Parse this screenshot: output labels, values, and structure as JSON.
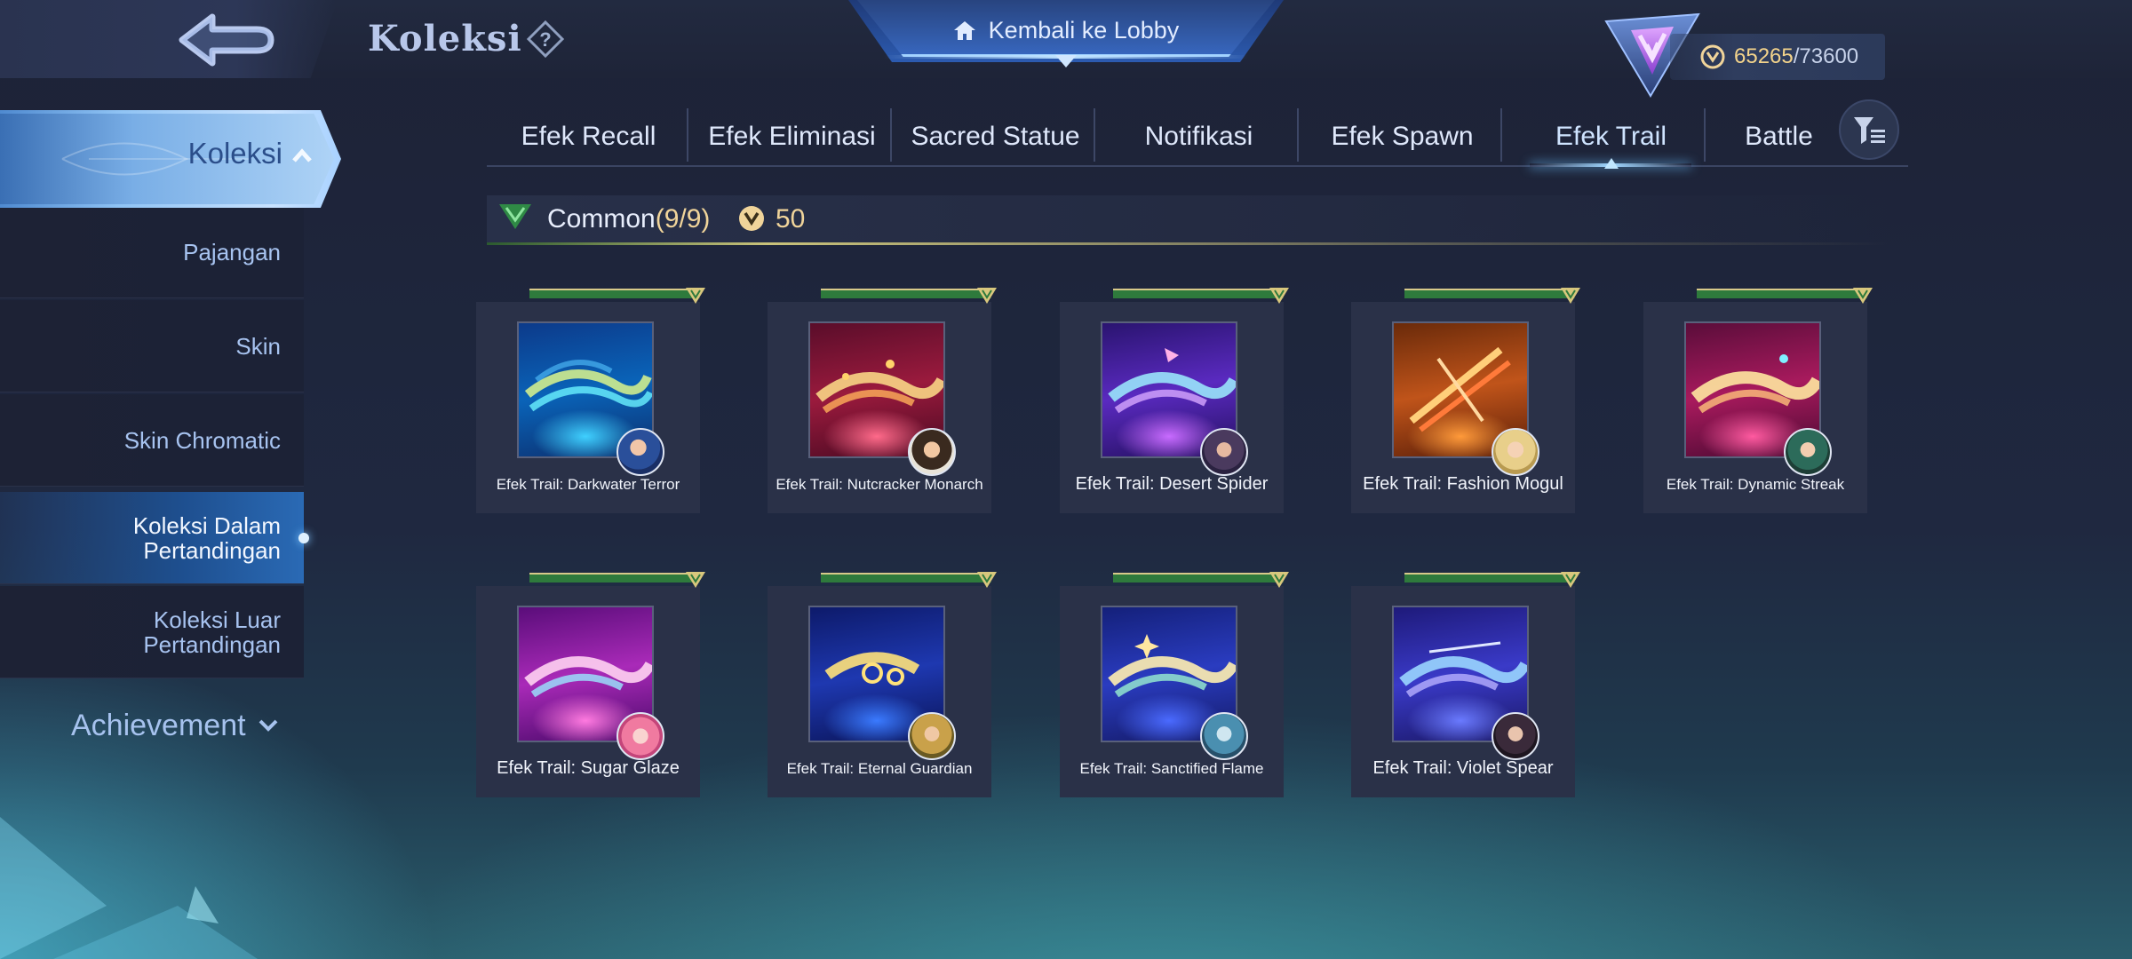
{
  "header": {
    "title": "Koleksi",
    "lobby_label": "Kembali ke Lobby",
    "currency_amount": "65265",
    "currency_max": "/73600"
  },
  "sidebar": {
    "section_label": "Koleksi",
    "items": [
      {
        "label": "Pajangan"
      },
      {
        "label": "Skin"
      },
      {
        "label": "Skin Chromatic"
      },
      {
        "label_line1": "Koleksi Dalam",
        "label_line2": "Pertandingan"
      },
      {
        "label_line1": "Koleksi Luar",
        "label_line2": "Pertandingan"
      }
    ],
    "achievement_label": "Achievement"
  },
  "tabs": [
    {
      "label": "Efek Recall"
    },
    {
      "label": "Efek Eliminasi"
    },
    {
      "label": "Sacred Statue"
    },
    {
      "label": "Notifikasi"
    },
    {
      "label": "Efek Spawn"
    },
    {
      "label": "Efek Trail",
      "active": true
    },
    {
      "label": "Battle"
    }
  ],
  "section": {
    "tier": "Common",
    "count": "(9/9)",
    "points": "50"
  },
  "items": [
    {
      "name": "Efek Trail: Darkwater Terror"
    },
    {
      "name": "Efek Trail: Nutcracker Monarch"
    },
    {
      "name": "Efek Trail: Desert Spider"
    },
    {
      "name": "Efek Trail: Fashion Mogul"
    },
    {
      "name": "Efek Trail: Dynamic Streak"
    },
    {
      "name": "Efek Trail: Sugar Glaze"
    },
    {
      "name": "Efek Trail: Eternal Guardian"
    },
    {
      "name": "Efek Trail: Sanctified Flame"
    },
    {
      "name": "Efek Trail: Violet Spear"
    }
  ],
  "colors": {
    "accent_blue": "#2a6ab5",
    "gold": "#f0d49a",
    "tier_green": "#3c8b45"
  },
  "icons": [
    "back-arrow-icon",
    "help-icon",
    "home-icon",
    "rank-emblem-icon",
    "battle-point-icon",
    "chevron-up-icon",
    "chevron-down-icon",
    "filter-icon",
    "tier-chevron-icon"
  ]
}
